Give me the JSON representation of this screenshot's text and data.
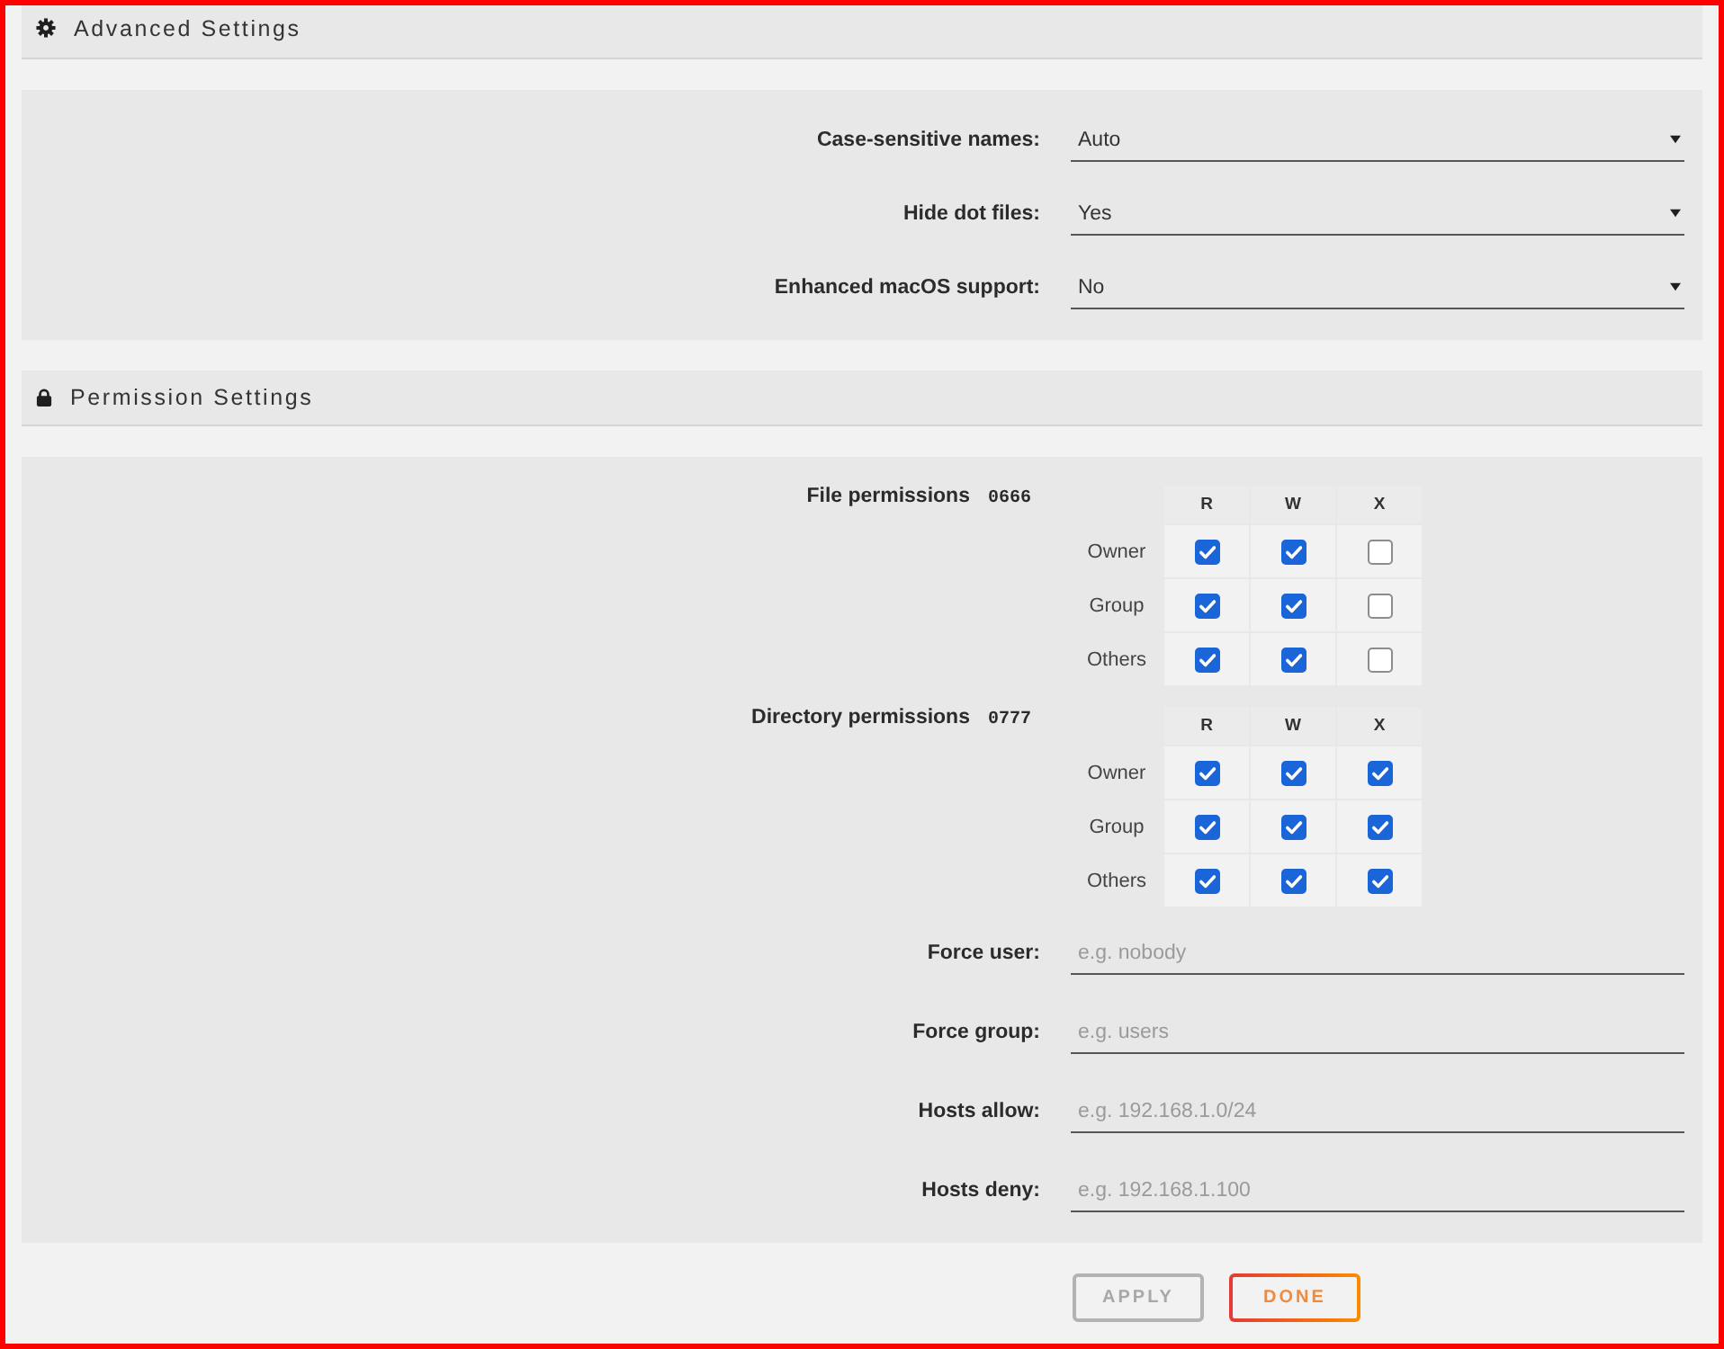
{
  "advanced_settings": {
    "title": "Advanced Settings",
    "fields": [
      {
        "label": "Case-sensitive names:",
        "value": "Auto"
      },
      {
        "label": "Hide dot files:",
        "value": "Yes"
      },
      {
        "label": "Enhanced macOS support:",
        "value": "No"
      }
    ]
  },
  "permission_settings": {
    "title": "Permission Settings",
    "tables": [
      {
        "label": "File permissions",
        "mode": "0666",
        "columns": [
          "R",
          "W",
          "X"
        ],
        "rows": [
          {
            "name": "Owner",
            "cells": [
              {
                "checked": true
              },
              {
                "checked": true
              },
              {
                "checked": false
              }
            ]
          },
          {
            "name": "Group",
            "cells": [
              {
                "checked": true
              },
              {
                "checked": true
              },
              {
                "checked": false
              }
            ]
          },
          {
            "name": "Others",
            "cells": [
              {
                "checked": true
              },
              {
                "checked": true
              },
              {
                "checked": false
              }
            ]
          }
        ]
      },
      {
        "label": "Directory permissions",
        "mode": "0777",
        "columns": [
          "R",
          "W",
          "X"
        ],
        "rows": [
          {
            "name": "Owner",
            "cells": [
              {
                "checked": true
              },
              {
                "checked": true
              },
              {
                "checked": true
              }
            ]
          },
          {
            "name": "Group",
            "cells": [
              {
                "checked": true
              },
              {
                "checked": true
              },
              {
                "checked": true
              }
            ]
          },
          {
            "name": "Others",
            "cells": [
              {
                "checked": true
              },
              {
                "checked": true
              },
              {
                "checked": true
              }
            ]
          }
        ]
      }
    ],
    "fields": [
      {
        "label": "Force user:",
        "placeholder": "e.g. nobody"
      },
      {
        "label": "Force group:",
        "placeholder": "e.g. users"
      },
      {
        "label": "Hosts allow:",
        "placeholder": "e.g. 192.168.1.0/24"
      },
      {
        "label": "Hosts deny:",
        "placeholder": "e.g. 192.168.1.100"
      }
    ]
  },
  "buttons": [
    {
      "label": "APPLY",
      "disabled": true
    },
    {
      "label": "DONE",
      "disabled": false
    }
  ]
}
